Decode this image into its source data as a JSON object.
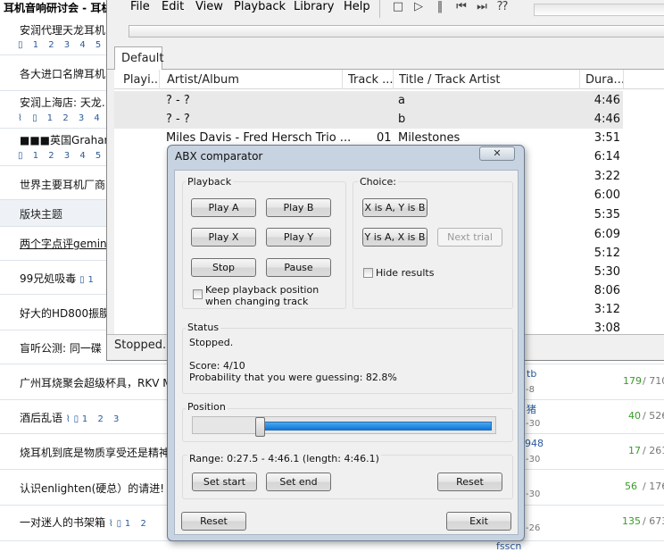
{
  "forum": {
    "title": "耳机音响研讨会 - 耳机",
    "section_label": "版块主题",
    "rows": [
      {
        "text": "安润代理天龙耳机",
        "pages": "1 2 3 4 5"
      },
      {
        "text": "各大进口名牌耳机",
        "pages": ""
      },
      {
        "text": "安润上海店: 天龙.",
        "pages": "1 2 3 4"
      },
      {
        "text": "■■■英国Graham M",
        "pages": "1 2 3 4 5"
      },
      {
        "text": "世界主要耳机厂商",
        "pages": ""
      },
      {
        "text": "两个字点评gemin",
        "pages": ""
      },
      {
        "text": "99兄処吸毒",
        "pages": "1"
      },
      {
        "text": "好大的HD800振膜",
        "pages": ""
      },
      {
        "text": "盲听公测: 同一碟",
        "pages": ""
      },
      {
        "text": "广州耳烧聚会超级杯具，RKV M",
        "pages": ""
      },
      {
        "text": "酒后乱语",
        "pages": "1 2 3"
      },
      {
        "text": "烧耳机到底是物质享受还是精神",
        "pages": ""
      },
      {
        "text": "认识enlighten(硬总）的请进!",
        "pages": ""
      },
      {
        "text": "一对迷人的书架箱",
        "pages": "1 2"
      }
    ],
    "right_users": [
      "tb",
      "猪",
      "948",
      "fsscn"
    ],
    "right_dates": [
      "-8",
      "-30",
      "-30",
      "-30",
      "-30",
      "-26"
    ],
    "right_counts": [
      "179",
      "/ 710",
      "40",
      "/ 526",
      "17",
      "/ 261",
      "56",
      "/ 176",
      "135",
      "/ 673"
    ]
  },
  "player": {
    "menu": [
      "File",
      "Edit",
      "View",
      "Playback",
      "Library",
      "Help"
    ],
    "toolbar_icons": [
      "stop-icon",
      "play-icon",
      "pause-icon",
      "previous-icon",
      "next-icon",
      "random-icon"
    ],
    "tab": "Default",
    "columns": [
      "Playi...",
      "Artist/Album",
      "Track ...",
      "Title / Track Artist",
      "Dura..."
    ],
    "tracks": [
      {
        "artist": "? - ?",
        "track": "",
        "title": "a",
        "duration": "4:46"
      },
      {
        "artist": "? - ?",
        "track": "",
        "title": "b",
        "duration": "4:46"
      },
      {
        "artist": "Miles Davis - Fred Hersch Trio ...",
        "track": "01",
        "title": "Milestones",
        "duration": "3:51"
      },
      {
        "artist": "",
        "track": "",
        "title": "",
        "duration": "6:14"
      },
      {
        "artist": "",
        "track": "",
        "title": "",
        "duration": "3:22"
      },
      {
        "artist": "",
        "track": "",
        "title": "",
        "duration": "6:00"
      },
      {
        "artist": "",
        "track": "",
        "title": "",
        "duration": "5:35"
      },
      {
        "artist": "",
        "track": "",
        "title": "",
        "duration": "6:09"
      },
      {
        "artist": "",
        "track": "",
        "title": "",
        "duration": "5:12"
      },
      {
        "artist": "",
        "track": "",
        "title": "",
        "duration": "5:30"
      },
      {
        "artist": "",
        "track": "",
        "title": "",
        "duration": "8:06"
      },
      {
        "artist": "",
        "track": "",
        "title": "",
        "duration": "3:12"
      },
      {
        "artist": "",
        "track": "",
        "title": "",
        "duration": "3:08"
      }
    ],
    "status": "Stopped."
  },
  "abx": {
    "title": "ABX comparator",
    "close_glyph": "✕",
    "playback_label": "Playback",
    "play_a": "Play A",
    "play_b": "Play B",
    "play_x": "Play X",
    "play_y": "Play Y",
    "stop": "Stop",
    "pause": "Pause",
    "keep_position": "Keep playback position when changing track",
    "choice_label": "Choice:",
    "x_is_a": "X is A, Y is B",
    "y_is_a": "Y is A, X is B",
    "next_trial": "Next trial",
    "hide_results": "Hide results",
    "status_label": "Status",
    "status_text": "Stopped.",
    "score": "Score: 4/10",
    "probability": "Probability that you were guessing: 82.8%",
    "position_label": "Position",
    "position_start_fraction": 0.1,
    "range_text": "Range: 0:27.5 - 4:46.1 (length: 4:46.1)",
    "set_start": "Set start",
    "set_end": "Set end",
    "range_reset": "Reset",
    "reset": "Reset",
    "exit": "Exit"
  }
}
